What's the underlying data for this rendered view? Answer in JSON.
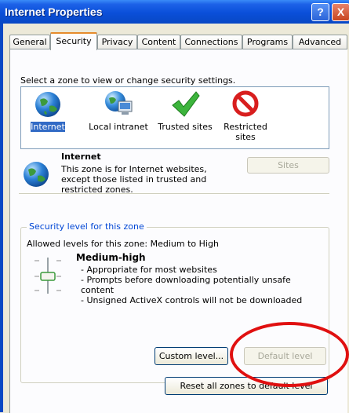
{
  "window": {
    "title": "Internet Properties",
    "help_label": "?",
    "close_label": "X"
  },
  "tabs": [
    "General",
    "Security",
    "Privacy",
    "Content",
    "Connections",
    "Programs",
    "Advanced"
  ],
  "active_tab": "Security",
  "security": {
    "select_prompt": "Select a zone to view or change security settings.",
    "zones": [
      {
        "label": "Internet",
        "icon": "globe-icon",
        "selected": true
      },
      {
        "label": "Local intranet",
        "icon": "intranet-icon",
        "selected": false
      },
      {
        "label": "Trusted sites",
        "icon": "checkmark-icon",
        "selected": false
      },
      {
        "label": "Restricted sites",
        "icon": "restricted-icon",
        "selected": false
      }
    ],
    "zone_title": "Internet",
    "zone_description": "This zone is for Internet websites, except those listed in trusted and restricted zones.",
    "sites_button": "Sites",
    "level_group_title": "Security level for this zone",
    "allowed_levels": "Allowed levels for this zone: Medium to High",
    "level_name": "Medium-high",
    "level_bullets": [
      "- Appropriate for most websites",
      "- Prompts before downloading potentially unsafe content",
      "- Unsigned ActiveX controls will not be downloaded"
    ],
    "custom_level_button": "Custom level...",
    "default_level_button": "Default level",
    "reset_button": "Reset all zones to default level"
  },
  "colors": {
    "titlebar": "#0a4fd9",
    "active_tab_accent": "#e68b2c",
    "group_title": "#0046d5",
    "selection": "#316ac5",
    "annotation": "#e01010"
  }
}
